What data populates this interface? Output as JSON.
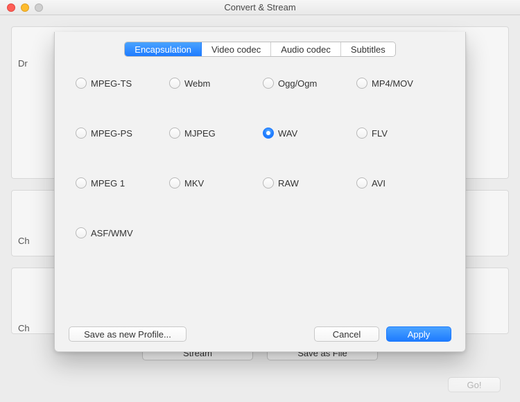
{
  "window": {
    "title": "Convert & Stream"
  },
  "parent": {
    "panel_a_label": "Dr",
    "panel_b_label": "Ch",
    "panel_c_label": "Ch",
    "stream_button": "Stream",
    "save_as_file_button": "Save as File",
    "go_button": "Go!"
  },
  "sheet": {
    "tabs": [
      {
        "label": "Encapsulation",
        "active": true
      },
      {
        "label": "Video codec",
        "active": false
      },
      {
        "label": "Audio codec",
        "active": false
      },
      {
        "label": "Subtitles",
        "active": false
      }
    ],
    "encapsulation_options": [
      {
        "label": "MPEG-TS",
        "selected": false
      },
      {
        "label": "Webm",
        "selected": false
      },
      {
        "label": "Ogg/Ogm",
        "selected": false
      },
      {
        "label": "MP4/MOV",
        "selected": false
      },
      {
        "label": "MPEG-PS",
        "selected": false
      },
      {
        "label": "MJPEG",
        "selected": false
      },
      {
        "label": "WAV",
        "selected": true
      },
      {
        "label": "FLV",
        "selected": false
      },
      {
        "label": "MPEG 1",
        "selected": false
      },
      {
        "label": "MKV",
        "selected": false
      },
      {
        "label": "RAW",
        "selected": false
      },
      {
        "label": "AVI",
        "selected": false
      },
      {
        "label": "ASF/WMV",
        "selected": false
      }
    ],
    "save_profile_button": "Save as new Profile...",
    "cancel_button": "Cancel",
    "apply_button": "Apply"
  }
}
